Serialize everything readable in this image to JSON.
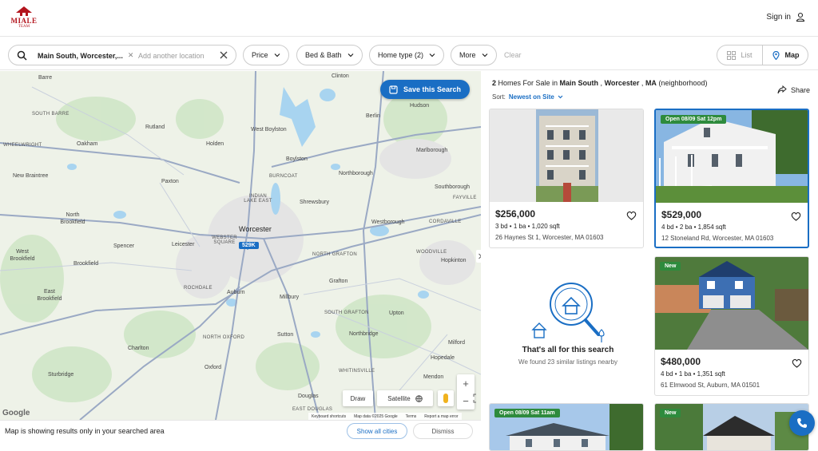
{
  "brand": {
    "name": "MIALE",
    "tagline": "TEAM",
    "color": "#b3141d"
  },
  "header": {
    "signin_label": "Sign in"
  },
  "filters": {
    "location_chip": "Main South, Worcester,...",
    "location_placeholder": "Add another location",
    "price_label": "Price",
    "bedbath_label": "Bed & Bath",
    "hometype_label": "Home type (2)",
    "more_label": "More",
    "clear_label": "Clear",
    "view_list_label": "List",
    "view_map_label": "Map"
  },
  "map": {
    "save_search_label": "Save this Search",
    "price_pin": "529K",
    "draw_label": "Draw",
    "satellite_label": "Satellite",
    "google_logo": "Google",
    "attribution": [
      "Keyboard shortcuts",
      "Map data ©2025 Google",
      "Terms",
      "Report a map error"
    ],
    "towns": [
      "Barre",
      "Clinton",
      "SOUTH BARRE",
      "Hudson",
      "Rutland",
      "Berlin",
      "West Boylston",
      "WHEELWRIGHT",
      "Oakham",
      "Holden",
      "Marlborough",
      "Boylston",
      "New Braintree",
      "Paxton",
      "BURNCOAT",
      "Northborough",
      "INDIAN LAKE EAST",
      "Southborough",
      "FAYVILLE",
      "Shrewsbury",
      "North Brookfield",
      "CORDAVILLE",
      "Worcester",
      "Westborough",
      "WEBSTER SQUARE",
      "Spencer",
      "Leicester",
      "West Brookfield",
      "Brookfield",
      "NORTH GRAFTON",
      "Hopkinton",
      "WOODVILLE",
      "Grafton",
      "ROCHDALE",
      "Auburn",
      "Millbury",
      "SOUTH GRAFTON",
      "Upton",
      "East Brookfield",
      "Charlton",
      "NORTH OXFORD",
      "Sutton",
      "Northbridge",
      "Milford",
      "Hopedale",
      "Sturbridge",
      "Oxford",
      "WHITINSVILLE",
      "Mendon",
      "Douglas",
      "EAST DOUGLAS"
    ],
    "bottom_note": "Map is showing results only in your searched area",
    "show_all_label": "Show all cities",
    "dismiss_label": "Dismiss",
    "colors": {
      "land": "#eef2e8",
      "water": "#a8d4f0",
      "road": "#9aa9c4",
      "park": "#cfe6c7",
      "urban": "#e7e7e7"
    }
  },
  "results": {
    "count": "2",
    "heading_mid": " Homes For Sale in ",
    "place": "Main South",
    "sep1": " , ",
    "city": "Worcester",
    "sep2": " , ",
    "state": "MA",
    "suffix": " (neighborhood)",
    "share_label": "Share",
    "sort_label": "Sort:",
    "sort_value": "Newest on Site",
    "listings": [
      {
        "price": "$256,000",
        "specs": "3 bd • 1 ba • 1,020 sqft",
        "address": "26 Haynes St 1, Worcester, MA 01603",
        "badge": ""
      },
      {
        "price": "$529,000",
        "specs": "4 bd • 2 ba • 1,854 sqft",
        "address": "12 Stoneland Rd, Worcester, MA 01603",
        "badge": "Open 08/09 Sat 12pm"
      },
      {
        "price": "$480,000",
        "specs": "4 bd • 1 ba • 1,351 sqft",
        "address": "61 Elmwood St, Auburn, MA 01501",
        "badge": "New"
      },
      {
        "price": "",
        "specs": "",
        "address": "",
        "badge": "Open 08/09 Sat 11am"
      },
      {
        "price": "",
        "specs": "",
        "address": "",
        "badge": "New"
      }
    ],
    "end_title": "That's all for this search",
    "end_sub": "We found 23 similar listings nearby"
  }
}
